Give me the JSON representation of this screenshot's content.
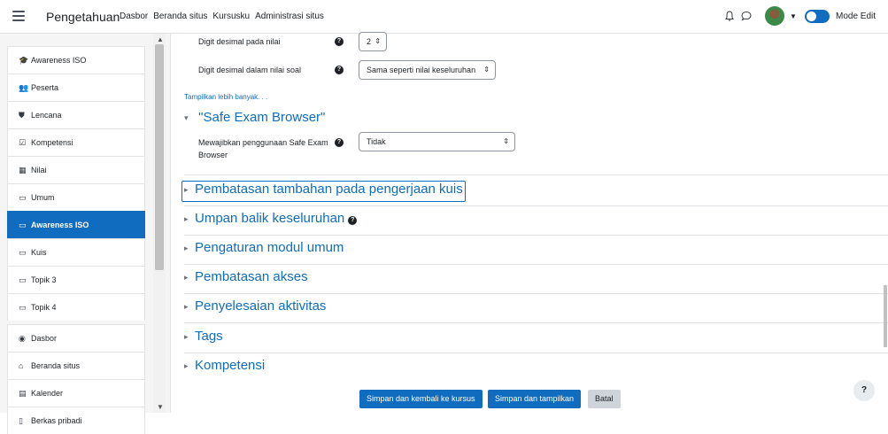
{
  "navbar": {
    "brand": "Pengetahuan",
    "links": [
      "Dasbor",
      "Beranda situs",
      "Kursusku",
      "Administrasi situs"
    ],
    "mode_edit_label": "Mode Edit"
  },
  "sidebar": {
    "items": [
      {
        "icon": "graduation-cap-icon",
        "glyph": "🎓",
        "label": "Awareness ISO"
      },
      {
        "icon": "users-icon",
        "glyph": "👥",
        "label": "Peserta"
      },
      {
        "icon": "shield-icon",
        "glyph": "⛊",
        "label": "Lencana"
      },
      {
        "icon": "check-square-icon",
        "glyph": "☑",
        "label": "Kompetensi"
      },
      {
        "icon": "table-icon",
        "glyph": "▦",
        "label": "Nilai"
      },
      {
        "icon": "folder-icon",
        "glyph": "▭",
        "label": "Umum"
      },
      {
        "icon": "folder-icon",
        "glyph": "▭",
        "label": "Awareness ISO",
        "active": true
      },
      {
        "icon": "folder-icon",
        "glyph": "▭",
        "label": "Kuis"
      },
      {
        "icon": "folder-icon",
        "glyph": "▭",
        "label": "Topik 3"
      },
      {
        "icon": "folder-icon",
        "glyph": "▭",
        "label": "Topik 4"
      },
      {
        "icon": "tachometer-icon",
        "glyph": "◉",
        "label": "Dasbor"
      },
      {
        "icon": "home-icon",
        "glyph": "⌂",
        "label": "Beranda situs"
      },
      {
        "icon": "calendar-icon",
        "glyph": "▤",
        "label": "Kalender"
      },
      {
        "icon": "file-icon",
        "glyph": "▯",
        "label": "Berkas pribadi"
      }
    ]
  },
  "form": {
    "decimal_grade_label": "Digit desimal pada nilai",
    "decimal_grade_value": "2",
    "decimal_question_label": "Digit desimal dalam nilai soal",
    "decimal_question_value": "Sama seperti nilai keseluruhan",
    "show_more": "Tampilkan lebih banyak. . .",
    "seb_section": "\"Safe Exam Browser\"",
    "seb_label_line1": "Mewajibkan penggunaan Safe Exam",
    "seb_label_line2": "Browser",
    "seb_value": "Tidak",
    "sections": [
      "Pembatasan tambahan pada pengerjaan kuis",
      "Umpan balik keseluruhan",
      "Pengaturan modul umum",
      "Pembatasan akses",
      "Penyelesaian aktivitas",
      "Tags",
      "Kompetensi"
    ]
  },
  "buttons": {
    "save_return": "Simpan dan kembali ke kursus",
    "save_display": "Simpan dan tampilkan",
    "cancel": "Batal"
  },
  "help_fab": "?"
}
